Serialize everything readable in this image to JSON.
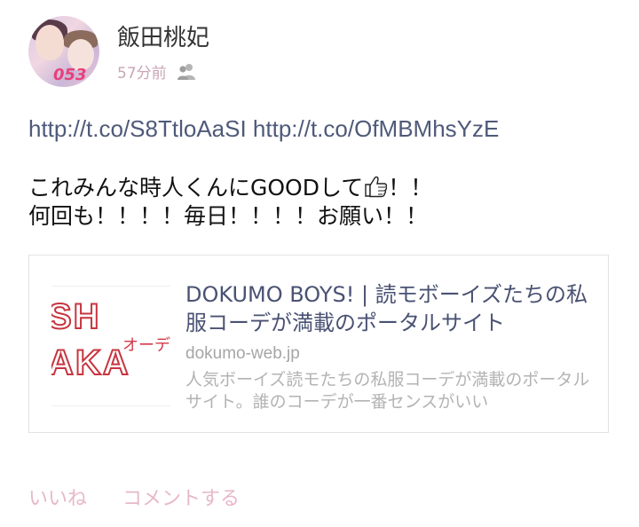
{
  "post": {
    "author_name": "飯田桃妃",
    "avatar_badge_text": "053",
    "time": "57分前",
    "privacy_icon": "friends-icon",
    "links": [
      "http://t.co/S8TtloAaSI",
      "http://t.co/OfMBMhsYzE"
    ],
    "text_line1_before_emoji": "これみんな時人くんにGOODして",
    "emoji": "thumbs-up-icon",
    "text_line1_after_emoji": "！！",
    "text_line2": "何回も！！！！毎日！！！！お願い！！"
  },
  "link_card": {
    "title": "DOKUMO BOYS! | 読モボーイズたちの私服コーデが満載のポータルサイト",
    "domain": "dokumo-web.jp",
    "description": "人気ボーイズ読モたちの私服コーデが満載のポータルサイト。誰のコーデが一番センスがいい",
    "thumbnail_text_1": "SH",
    "thumbnail_text_2": "AKA",
    "thumbnail_text_3": "オーデ"
  },
  "actions": {
    "like_label": "いいね",
    "comment_label": "コメントする"
  },
  "colors": {
    "link": "#4f5a7a",
    "meta": "#c9a6b6",
    "action": "#e6b8ca",
    "badge": "#e8407a"
  }
}
